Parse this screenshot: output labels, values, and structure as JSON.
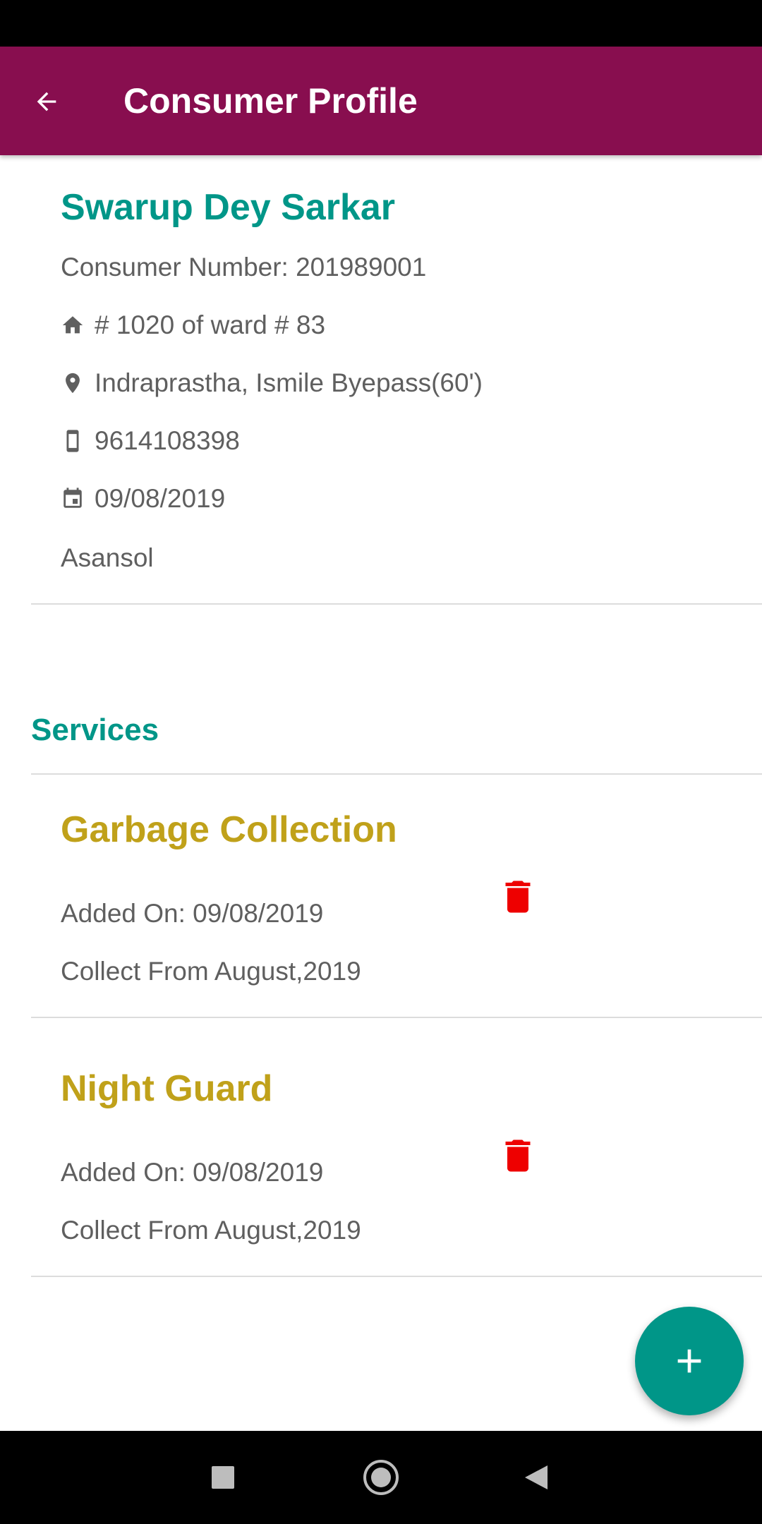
{
  "app_bar": {
    "title": "Consumer Profile",
    "back_icon": "arrow-back-icon",
    "background": "#880e4f"
  },
  "profile": {
    "name": "Swarup Dey Sarkar",
    "consumer_number": "Consumer Number: 201989001",
    "house": "# 1020 of ward # 83",
    "address": "Indraprastha, Ismile Byepass(60')",
    "phone": "9614108398",
    "date": "09/08/2019",
    "city": "Asansol"
  },
  "services": {
    "title": "Services",
    "items": [
      {
        "name": "Garbage Collection",
        "added_on": "Added On: 09/08/2019",
        "collect_from": "Collect From August,2019"
      },
      {
        "name": "Night Guard",
        "added_on": "Added On: 09/08/2019",
        "collect_from": "Collect From August,2019"
      }
    ]
  },
  "colors": {
    "accent": "#009688",
    "service_title": "#c0a11a",
    "delete": "#ee0000"
  },
  "icons": [
    "home-icon",
    "location-pin-icon",
    "phone-icon",
    "calendar-icon",
    "trash-icon",
    "plus-icon"
  ]
}
